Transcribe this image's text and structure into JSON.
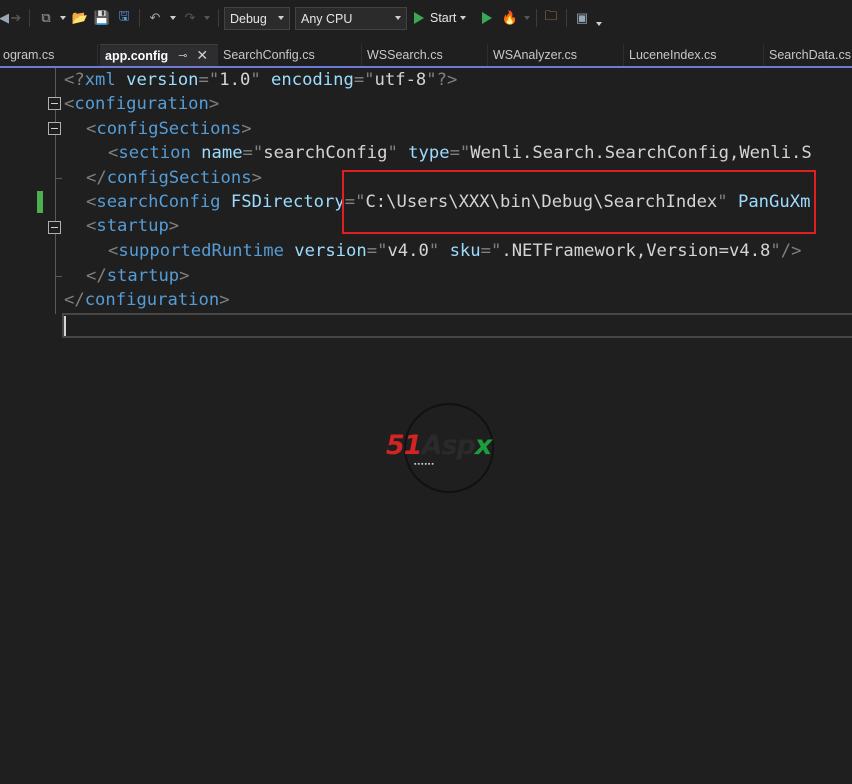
{
  "toolbar": {
    "config_value": "Debug",
    "platform_value": "Any CPU",
    "start_label": "Start"
  },
  "tabs": [
    {
      "label": "ogram.cs",
      "active": false
    },
    {
      "label": "app.config",
      "active": true
    },
    {
      "label": "SearchConfig.cs",
      "active": false
    },
    {
      "label": "WSSearch.cs",
      "active": false
    },
    {
      "label": "WSAnalyzer.cs",
      "active": false
    },
    {
      "label": "LuceneIndex.cs",
      "active": false
    },
    {
      "label": "SearchData.cs",
      "active": false
    }
  ],
  "tab_icons": {
    "pin": "pin-icon",
    "close": "close-icon"
  },
  "code": {
    "line1": {
      "open": "<?",
      "tag": "xml",
      "a1": " version",
      "eq1": "=",
      "q1": "\"",
      "v1": "1.0",
      "q2": "\"",
      "a2": " encoding",
      "eq2": "=",
      "q3": "\"",
      "v2": "utf-8",
      "q4": "\"",
      "close": "?>"
    },
    "line2": {
      "lt": "<",
      "tag": "configuration",
      "gt": ">"
    },
    "line3": {
      "lt": "<",
      "tag": "configSections",
      "gt": ">"
    },
    "line4": {
      "lt": "<",
      "tag": "section",
      "a1": " name",
      "eq1": "=",
      "q1": "\"",
      "v1": "searchConfig",
      "q2": "\"",
      "a2": " type",
      "eq2": "=",
      "q3": "\"",
      "v2": "Wenli.Search.SearchConfig,Wenli.S"
    },
    "line5": {
      "lt": "</",
      "tag": "configSections",
      "gt": ">"
    },
    "line6": {
      "lt": "<",
      "tag": "searchConfig",
      "a1": " FSDirectory",
      "eq1": "=",
      "q1": "\"",
      "v1": "C:\\Users\\XXX\\bin\\Debug\\SearchIndex",
      "q2": "\"",
      "a2": " PanGuXm"
    },
    "line7": {
      "lt": "<",
      "tag": "startup",
      "gt": ">"
    },
    "line8": {
      "lt": "<",
      "tag": "supportedRuntime",
      "a1": " version",
      "eq1": "=",
      "q1": "\"",
      "v1": "v4.0",
      "q2": "\"",
      "a2": " sku",
      "eq2": "=",
      "q3": "\"",
      "v2": ".NETFramework,Version=v4.8",
      "q4": "\"",
      "close": "/>"
    },
    "line9": {
      "lt": "</",
      "tag": "startup",
      "gt": ">"
    },
    "line10": {
      "lt": "</",
      "tag": "configuration",
      "gt": ">"
    }
  },
  "colors": {
    "tag": "#569cd6",
    "attribute": "#9cdcfe",
    "punctuation": "#808080",
    "value": "#d4d4d4",
    "highlight_box": "#e02020",
    "tab_accent": "#6b7bd6"
  },
  "watermark": {
    "brand_51": "51",
    "brand_asp": "Asp",
    "brand_x": "x"
  }
}
